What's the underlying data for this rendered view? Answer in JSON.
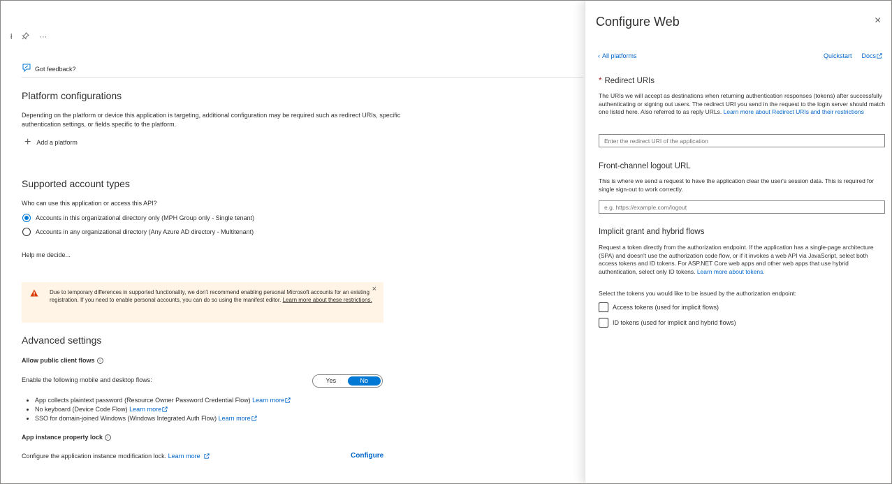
{
  "colors": {
    "accent": "#0078d4",
    "link": "#0066cc",
    "warning_bg": "#fff4e5",
    "warning_icon": "#d83b01"
  },
  "left": {
    "topbar": {
      "mark": "ł",
      "pin_icon": "pin-icon",
      "more": "···"
    },
    "feedback": {
      "label": "Got feedback?"
    },
    "platform": {
      "title": "Platform configurations",
      "description": "Depending on the platform or device this application is targeting, additional configuration may be required such as redirect URIs, specific authentication settings, or fields specific to the platform.",
      "add_label": "Add a platform"
    },
    "accounts": {
      "title": "Supported account types",
      "question": "Who can use this application or access this API?",
      "options": [
        {
          "label": "Accounts in this organizational directory only (MPH Group only - Single tenant)",
          "selected": true
        },
        {
          "label": "Accounts in any organizational directory (Any Azure AD directory - Multitenant)",
          "selected": false
        }
      ],
      "help_link": "Help me decide..."
    },
    "warning": {
      "text": "Due to temporary differences in supported functionality, we don't recommend enabling personal Microsoft accounts for an existing registration. If you need to enable personal accounts, you can do so using the manifest editor.",
      "link": "Learn more about these restrictions.",
      "close": "×"
    },
    "advanced": {
      "title": "Advanced settings",
      "public_client_label": "Allow public client flows",
      "enable_text": "Enable the following mobile and desktop flows:",
      "toggle": {
        "yes": "Yes",
        "no": "No",
        "selected": "No"
      },
      "flows": [
        {
          "text": "App collects plaintext password (Resource Owner Password Credential Flow)",
          "link": "Learn more"
        },
        {
          "text": "No keyboard (Device Code Flow)",
          "link": "Learn more"
        },
        {
          "text": "SSO for domain-joined Windows (Windows Integrated Auth Flow)",
          "link": "Learn more"
        }
      ],
      "lock_label": "App instance property lock",
      "lock_text": "Configure the application instance modification lock.",
      "lock_link": "Learn more",
      "configure": "Configure"
    }
  },
  "panel": {
    "title": "Configure Web",
    "close": "×",
    "back_link": "All platforms",
    "quickstart": "Quickstart",
    "docs": "Docs",
    "redirect": {
      "title": "Redirect URIs",
      "required_mark": "*",
      "description": "The URIs we will accept as destinations when returning authentication responses (tokens) after successfully authenticating or signing out users. The redirect URI you send in the request to the login server should match one listed here. Also referred to as reply URLs.",
      "link": "Learn more about Redirect URIs and their restrictions",
      "placeholder": "Enter the redirect URI of the application"
    },
    "logout": {
      "title": "Front-channel logout URL",
      "description": "This is where we send a request to have the application clear the user's session data. This is required for single sign-out to work correctly.",
      "placeholder": "e.g. https://example.com/logout"
    },
    "implicit": {
      "title": "Implicit grant and hybrid flows",
      "description": "Request a token directly from the authorization endpoint. If the application has a single-page architecture (SPA) and doesn't use the authorization code flow, or if it invokes a web API via JavaScript, select both access tokens and ID tokens. For ASP.NET Core web apps and other web apps that use hybrid authentication, select only ID tokens.",
      "link": "Learn more about tokens.",
      "select_text": "Select the tokens you would like to be issued by the authorization endpoint:",
      "checkboxes": [
        {
          "label": "Access tokens (used for implicit flows)",
          "checked": false
        },
        {
          "label": "ID tokens (used for implicit and hybrid flows)",
          "checked": false
        }
      ]
    }
  }
}
